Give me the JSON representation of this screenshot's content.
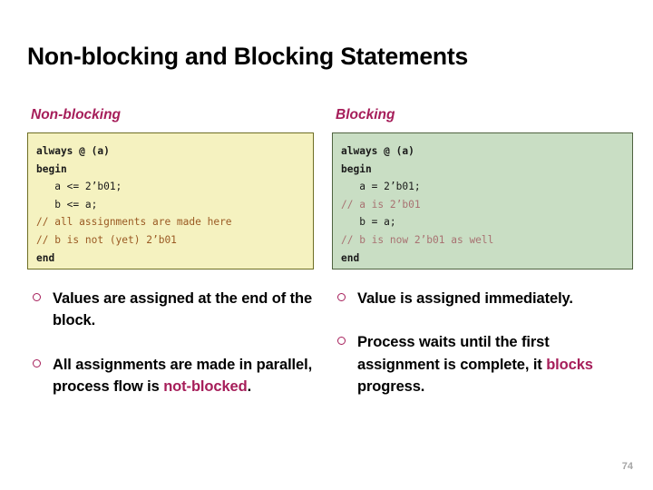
{
  "slide": {
    "title": "Non-blocking and Blocking Statements",
    "page_number": "74",
    "accent_color": "#A61E5A",
    "columns": [
      {
        "heading": "Non-blocking",
        "code_box": {
          "background_color": "#F5F2C0",
          "border_color": "#6E6E24",
          "comment_color": "#9A5A23",
          "lines": [
            {
              "text": "always @ (a)",
              "style": "keyword"
            },
            {
              "text": "begin",
              "style": "keyword"
            },
            {
              "text": "   a <= 2’b01;",
              "style": "code"
            },
            {
              "text": "   b <= a;",
              "style": "code"
            },
            {
              "text": "// all assignments are made here",
              "style": "comment"
            },
            {
              "text": "// b is not (yet) 2’b01",
              "style": "comment"
            },
            {
              "text": "end",
              "style": "keyword"
            }
          ]
        },
        "bullets": [
          {
            "segments": [
              {
                "text": "Values are assigned at the end of the block.",
                "highlight": false
              }
            ]
          },
          {
            "segments": [
              {
                "text": "All assignments are made in parallel, process flow is ",
                "highlight": false
              },
              {
                "text": "not-blocked",
                "highlight": true
              },
              {
                "text": ".",
                "highlight": false
              }
            ]
          }
        ]
      },
      {
        "heading": "Blocking",
        "code_box": {
          "background_color": "#C9DEC4",
          "border_color": "#4F6340",
          "comment_color": "#A87272",
          "lines": [
            {
              "text": "always @ (a)",
              "style": "keyword"
            },
            {
              "text": "begin",
              "style": "keyword"
            },
            {
              "text": "   a = 2’b01;",
              "style": "code"
            },
            {
              "text": "// a is 2’b01",
              "style": "comment"
            },
            {
              "text": "   b = a;",
              "style": "code"
            },
            {
              "text": "// b is now 2’b01 as well",
              "style": "comment"
            },
            {
              "text": "end",
              "style": "keyword"
            }
          ]
        },
        "bullets": [
          {
            "segments": [
              {
                "text": "Value is assigned immediately.",
                "highlight": false
              }
            ]
          },
          {
            "segments": [
              {
                "text": "Process waits until the first assignment is complete, it ",
                "highlight": false
              },
              {
                "text": "blocks",
                "highlight": true
              },
              {
                "text": " progress.",
                "highlight": false
              }
            ]
          }
        ]
      }
    ]
  }
}
